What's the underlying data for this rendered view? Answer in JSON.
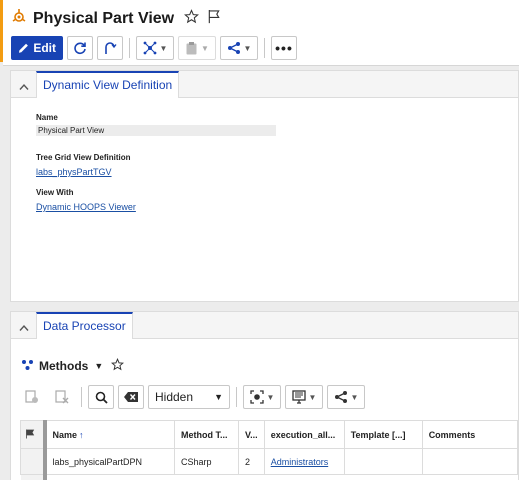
{
  "header": {
    "title": "Physical Part View",
    "edit_label": "Edit"
  },
  "definition_panel": {
    "tab_label": "Dynamic View Definition",
    "name_label": "Name",
    "name_value": "Physical Part View",
    "tree_grid_label": "Tree Grid View Definition",
    "tree_grid_value": "labs_physPartTGV",
    "view_with_label": "View With",
    "view_with_value": "Dynamic HOOPS Viewer"
  },
  "processor_panel": {
    "tab_label": "Data Processor",
    "methods_label": "Methods",
    "hidden_select": "Hidden",
    "columns": [
      "Name",
      "Method T...",
      "V...",
      "execution_all...",
      "Template [...]",
      "Comments"
    ],
    "rows": [
      {
        "name": "labs_physicalPartDPN",
        "method_type": "CSharp",
        "version": "2",
        "execution": "Administrators",
        "template": "",
        "comments": ""
      }
    ]
  },
  "colors": {
    "accent": "#1843b4",
    "brand_orange": "#f39c12",
    "link": "#1a4fa3"
  }
}
